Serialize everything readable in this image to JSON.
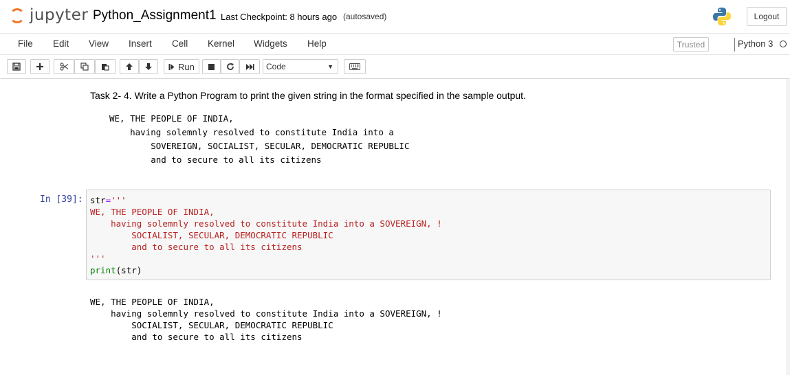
{
  "header": {
    "logo_text": "jupyter",
    "notebook_name": "Python_Assignment1",
    "checkpoint": "Last Checkpoint: 8 hours ago",
    "autosave": "(autosaved)",
    "logout_label": "Logout"
  },
  "menu": {
    "items": [
      "File",
      "Edit",
      "View",
      "Insert",
      "Cell",
      "Kernel",
      "Widgets",
      "Help"
    ],
    "trusted": "Trusted",
    "kernel": "Python 3"
  },
  "toolbar": {
    "run_label": "Run",
    "cell_type": "Code"
  },
  "cells": {
    "markdown": {
      "text": "Task 2- 4. Write a Python Program to print the given string in the format specified in the sample output.",
      "sample": [
        "WE, THE PEOPLE OF INDIA,",
        "    having solemnly resolved to constitute India into a",
        "        SOVEREIGN, SOCIALIST, SECULAR, DEMOCRATIC REPUBLIC",
        "        and to secure to all its citizens"
      ]
    },
    "code": {
      "prompt": "In [39]:",
      "var": "str",
      "op": "=",
      "str_open": "'''",
      "str_lines": [
        "WE, THE PEOPLE OF INDIA,",
        "    having solemnly resolved to constitute India into a SOVEREIGN, !",
        "        SOCIALIST, SECULAR, DEMOCRATIC REPUBLIC",
        "        and to secure to all its citizens"
      ],
      "str_close": "'''",
      "print_fn": "print",
      "print_arg": "(str)"
    },
    "output": [
      "WE, THE PEOPLE OF INDIA,",
      "    having solemnly resolved to constitute India into a SOVEREIGN, !",
      "        SOCIALIST, SECULAR, DEMOCRATIC REPUBLIC",
      "        and to secure to all its citizens"
    ]
  },
  "colors": {
    "jupyter_orange": "#f37626",
    "prompt_blue": "#303f9f",
    "string_red": "#ba2121",
    "builtin_green": "#008000"
  }
}
